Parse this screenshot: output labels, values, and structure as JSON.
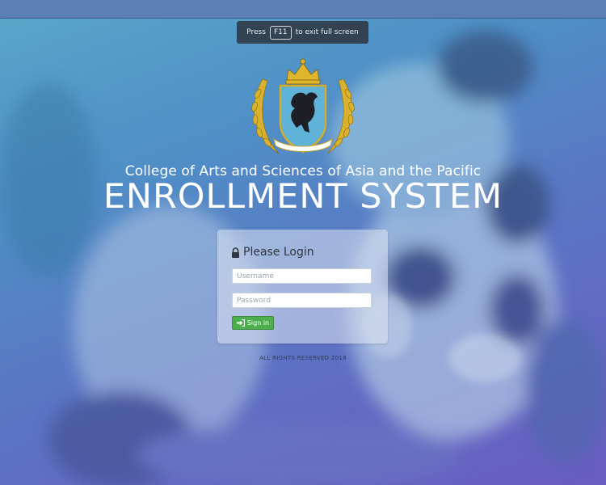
{
  "fullscreen_notice": {
    "prefix": "Press",
    "key": "F11",
    "suffix": "to exit full screen"
  },
  "header": {
    "college_name": "College of Arts and Sciences of Asia and the Pacific",
    "system_title": "ENROLLMENT SYSTEM"
  },
  "login": {
    "heading": "Please Login",
    "username_placeholder": "Username",
    "password_placeholder": "Password",
    "signin_label": "Sign in"
  },
  "footer": {
    "text": "ALL RIGHTS RESERVED 2018"
  },
  "colors": {
    "accent_green": "#4cae4c",
    "background_top": "#5aa8c9",
    "background_bottom": "#6a5cc0"
  },
  "icons": {
    "lock": "lock-icon",
    "signin": "sign-in-icon",
    "crest": "crest-logo"
  }
}
